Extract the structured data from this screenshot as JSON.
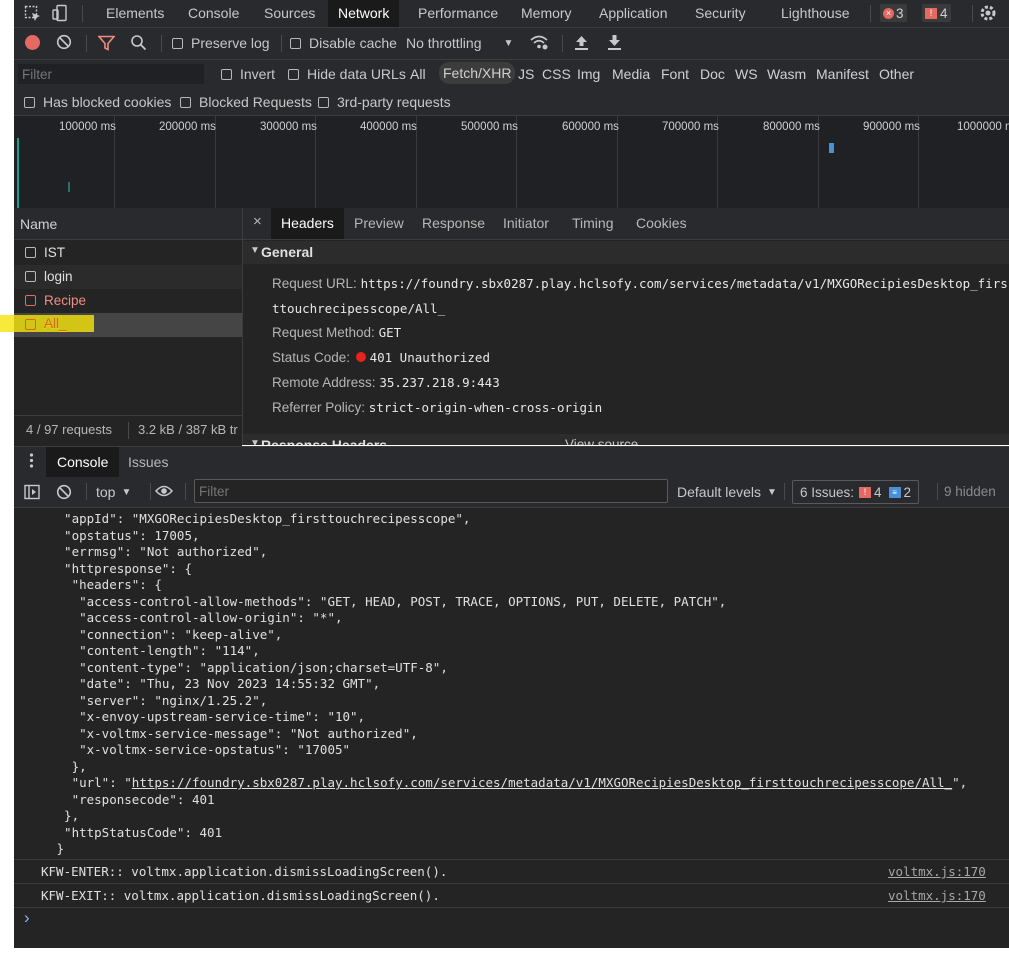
{
  "top_tabs": [
    "Elements",
    "Console",
    "Sources",
    "Network",
    "Performance",
    "Memory",
    "Application",
    "Security",
    "Lighthouse"
  ],
  "errors_count": "3",
  "warnings_count": "4",
  "toolbar": {
    "preserve_log": "Preserve log",
    "disable_cache": "Disable cache",
    "throttling": "No throttling"
  },
  "filter_bar": {
    "placeholder": "Filter",
    "invert": "Invert",
    "hide_data_urls": "Hide data URLs",
    "types": [
      "All",
      "Fetch/XHR",
      "JS",
      "CSS",
      "Img",
      "Media",
      "Font",
      "Doc",
      "WS",
      "Wasm",
      "Manifest",
      "Other"
    ],
    "active_type": "Fetch/XHR",
    "has_blocked_cookies": "Has blocked cookies",
    "blocked_requests": "Blocked Requests",
    "third_party": "3rd-party requests"
  },
  "timeline_ticks": [
    "100000 ms",
    "200000 ms",
    "300000 ms",
    "400000 ms",
    "500000 ms",
    "600000 ms",
    "700000 ms",
    "800000 ms",
    "900000 ms",
    "1000000 ms"
  ],
  "request_list": {
    "header": "Name",
    "items": [
      {
        "name": "IST",
        "status": "ok"
      },
      {
        "name": "login",
        "status": "ok"
      },
      {
        "name": "Recipe",
        "status": "error"
      },
      {
        "name": "All_",
        "status": "error"
      }
    ],
    "summary_requests": "4 / 97 requests",
    "summary_size": "3.2 kB / 387 kB tr"
  },
  "detail_tabs": [
    "Headers",
    "Preview",
    "Response",
    "Initiator",
    "Timing",
    "Cookies"
  ],
  "general": {
    "section_title": "General",
    "request_url_label": "Request URL:",
    "request_url_line1": "https://foundry.sbx0287.play.hclsofy.com/services/metadata/v1/MXGORecipiesDesktop_firs",
    "request_url_line2": "ttouchrecipesscope/All_",
    "request_method_label": "Request Method:",
    "request_method": "GET",
    "status_code_label": "Status Code:",
    "status_code": "401 Unauthorized",
    "remote_address_label": "Remote Address:",
    "remote_address": "35.237.218.9:443",
    "referrer_policy_label": "Referrer Policy:",
    "referrer_policy": "strict-origin-when-cross-origin",
    "next_section": "Response Headers",
    "view_source": "View source"
  },
  "drawer_tabs": [
    "Console",
    "Issues"
  ],
  "console_toolbar": {
    "context": "top",
    "filter_placeholder": "Filter",
    "levels": "Default levels",
    "issues_label": "6 Issues:",
    "issues_errors": "4",
    "issues_info": "2",
    "hidden": "9 hidden"
  },
  "console_lines": [
    "  \"appId\": \"MXGORecipiesDesktop_firsttouchrecipesscope\",",
    "  \"opstatus\": 17005,",
    "  \"errmsg\": \"Not authorized\",",
    "  \"httpresponse\": {",
    "   \"headers\": {",
    "    \"access-control-allow-methods\": \"GET, HEAD, POST, TRACE, OPTIONS, PUT, DELETE, PATCH\",",
    "    \"access-control-allow-origin\": \"*\",",
    "    \"connection\": \"keep-alive\",",
    "    \"content-length\": \"114\",",
    "    \"content-type\": \"application/json;charset=UTF-8\",",
    "    \"date\": \"Thu, 23 Nov 2023 14:55:32 GMT\",",
    "    \"server\": \"nginx/1.25.2\",",
    "    \"x-envoy-upstream-service-time\": \"10\",",
    "    \"x-voltmx-service-message\": \"Not authorized\",",
    "    \"x-voltmx-service-opstatus\": \"17005\"",
    "   },"
  ],
  "console_url_prefix": "   \"url\": \"",
  "console_url": "https://foundry.sbx0287.play.hclsofy.com/services/metadata/v1/MXGORecipiesDesktop_firsttouchrecipesscope/All_",
  "console_url_suffix": "\",",
  "console_lines_after": [
    "   \"responsecode\": 401",
    "  },",
    "  \"httpStatusCode\": 401",
    " }"
  ],
  "console_messages": [
    {
      "text": "KFW-ENTER:: voltmx.application.dismissLoadingScreen().",
      "source": "voltmx.js:170"
    },
    {
      "text": "KFW-EXIT:: voltmx.application.dismissLoadingScreen().",
      "source": "voltmx.js:170"
    }
  ],
  "prompt": "›",
  "colors": {
    "panel_bg": "#242424",
    "toolbar_bg": "#292a2d",
    "error_red": "#f28b82",
    "record_red": "#e46962",
    "highlight_yellow": "#f5e50a",
    "link_blue": "#8ab4f8"
  }
}
